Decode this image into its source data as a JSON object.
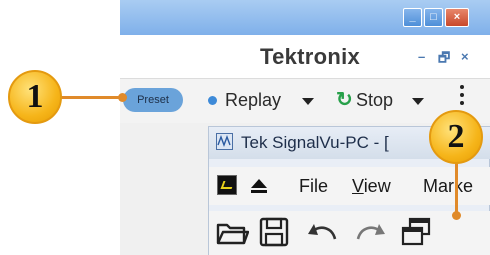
{
  "window": {
    "min_glyph": "_",
    "max_glyph": "□",
    "close_glyph": "×"
  },
  "brand": {
    "name": "Tektronix",
    "min_glyph": "–",
    "restore_glyph": "🗗",
    "close_glyph": "×"
  },
  "toolbar": {
    "preset_label": "Preset",
    "replay_label": "Replay",
    "stop_label": "Stop",
    "refresh_glyph": "↻"
  },
  "signalvu": {
    "title": "Tek SignalVu-PC - [",
    "menu": {
      "file": "File",
      "view_u": "V",
      "view_rest": "iew",
      "markers": "Marke"
    },
    "icons": [
      "open-folder-icon",
      "save-icon",
      "undo-icon",
      "redo-icon",
      "cascade-windows-icon"
    ]
  },
  "callouts": {
    "one": "1",
    "two": "2"
  },
  "colors": {
    "accent_blue": "#3d8ad8",
    "preset_bg": "#6aa3da",
    "callout_orange": "#f6b51a",
    "leader": "#e08a2a",
    "refresh_green": "#27a04a"
  }
}
